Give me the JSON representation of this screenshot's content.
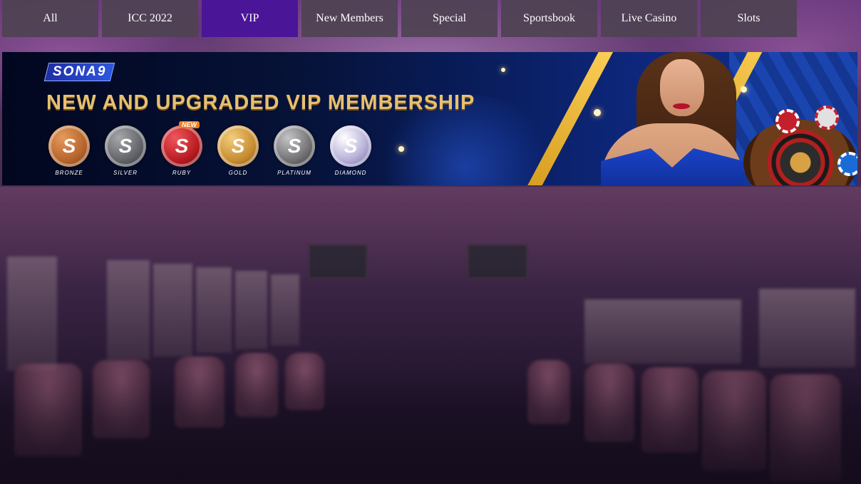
{
  "nav": {
    "tabs": [
      {
        "label": "All",
        "active": false
      },
      {
        "label": "ICC 2022",
        "active": false
      },
      {
        "label": "VIP",
        "active": true
      },
      {
        "label": "New Members",
        "active": false
      },
      {
        "label": "Special",
        "active": false
      },
      {
        "label": "Sportsbook",
        "active": false
      },
      {
        "label": "Live Casino",
        "active": false
      },
      {
        "label": "Slots",
        "active": false
      }
    ]
  },
  "banner": {
    "logo_text": "SONA9",
    "headline": "NEW AND UPGRADED VIP MEMBERSHIP",
    "new_badge": "NEW",
    "coins": [
      {
        "label": "BRONZE",
        "color": "#b4622a"
      },
      {
        "label": "SILVER",
        "color": "#5f6166"
      },
      {
        "label": "RUBY",
        "color": "#b51a1f"
      },
      {
        "label": "GOLD",
        "color": "#c68a2e"
      },
      {
        "label": "PLATINUM",
        "color": "#6e6e70"
      },
      {
        "label": "DIAMOND",
        "color": "#b9b2d8"
      }
    ],
    "coin_glyph": "S"
  },
  "colors": {
    "tab_bg": "#4e4252",
    "tab_active_bg": "#4a1596",
    "headline_gold": "#e7c070"
  }
}
